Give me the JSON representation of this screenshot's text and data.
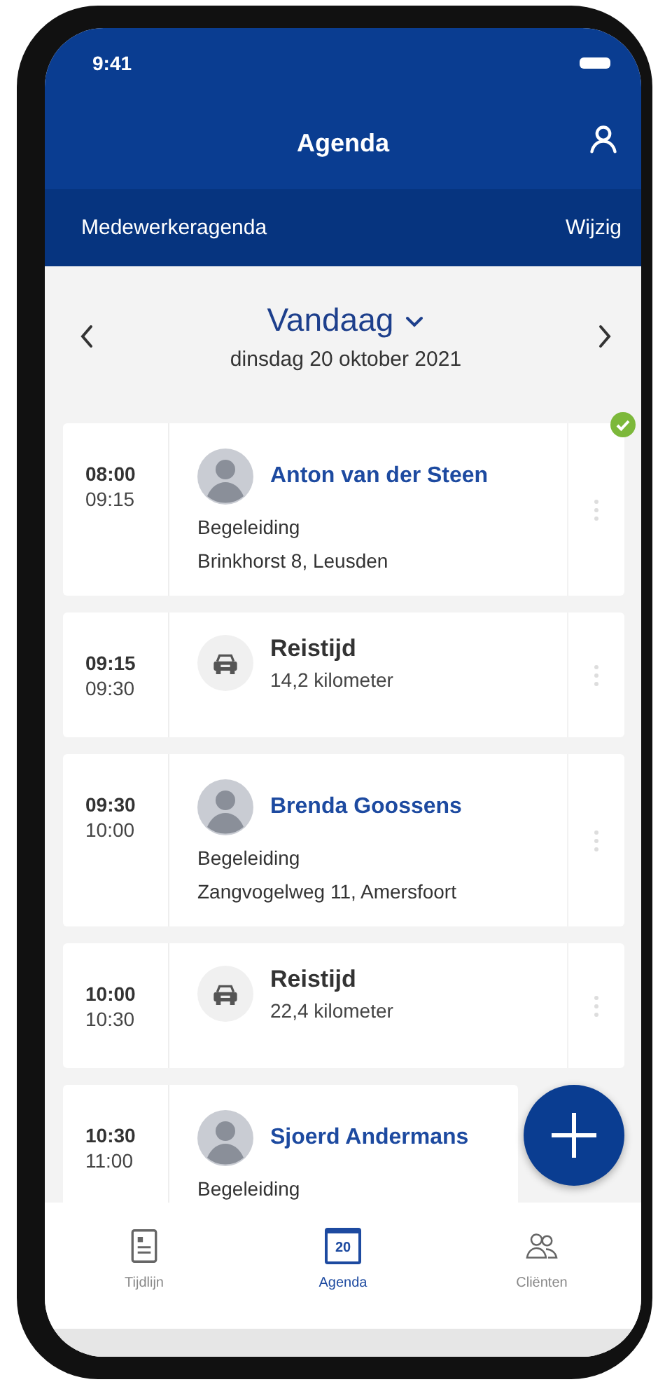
{
  "status_bar": {
    "time": "9:41"
  },
  "header": {
    "title": "Agenda"
  },
  "sub_bar": {
    "label": "Medewerkeragenda",
    "action": "Wijzig"
  },
  "date_nav": {
    "title": "Vandaag",
    "date": "dinsdag 20 oktober 2021"
  },
  "items": [
    {
      "kind": "appointment",
      "start": "08:00",
      "end": "09:15",
      "name": "Anton van der Steen",
      "type": "Begeleiding",
      "address": "Brinkhorst 8, Leusden",
      "completed": true
    },
    {
      "kind": "travel",
      "start": "09:15",
      "end": "09:30",
      "title": "Reistijd",
      "distance": "14,2 kilometer",
      "completed": false
    },
    {
      "kind": "appointment",
      "start": "09:30",
      "end": "10:00",
      "name": "Brenda Goossens",
      "type": "Begeleiding",
      "address": "Zangvogelweg 11, Amersfoort",
      "completed": false
    },
    {
      "kind": "travel",
      "start": "10:00",
      "end": "10:30",
      "title": "Reistijd",
      "distance": "22,4 kilometer",
      "completed": false
    },
    {
      "kind": "appointment",
      "start": "10:30",
      "end": "11:00",
      "name": "Sjoerd Andermans",
      "type": "Begeleiding",
      "completed": false
    }
  ],
  "tabs": [
    {
      "kind": "timeline",
      "label": "Tijdlijn",
      "selected": false
    },
    {
      "kind": "calendar",
      "label": "Agenda",
      "selected": true,
      "day": "20"
    },
    {
      "kind": "clients",
      "label": "Cliënten",
      "selected": false
    }
  ]
}
